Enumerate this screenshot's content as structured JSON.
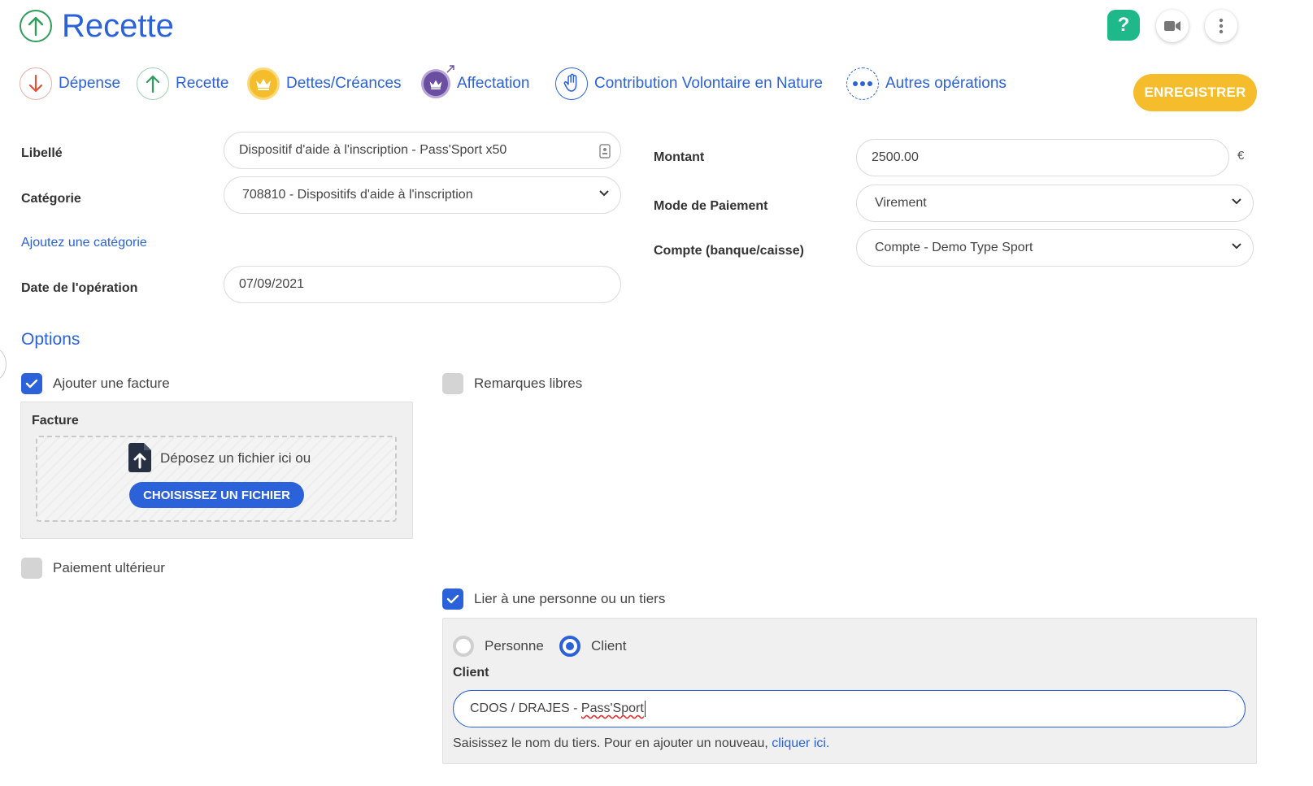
{
  "header": {
    "title": "Recette",
    "help_label": "?"
  },
  "operations": [
    {
      "label": "Dépense",
      "icon": "arrow-down-icon",
      "color": "#e0533d"
    },
    {
      "label": "Recette",
      "icon": "arrow-up-icon",
      "color": "#2e9e5b"
    },
    {
      "label": "Dettes/Créances",
      "icon": "crown-icon",
      "color": "#f5bd2b"
    },
    {
      "label": "Affectation",
      "icon": "crown-arrow-icon",
      "color": "#6b4ea0"
    },
    {
      "label": "Contribution Volontaire en Nature",
      "icon": "hand-icon",
      "color": "#2b62d9"
    },
    {
      "label": "Autres opérations",
      "icon": "more-horizontal-icon",
      "color": "#2b62d9"
    }
  ],
  "save_label": "ENREGISTRER",
  "form": {
    "libelle_label": "Libellé",
    "libelle_value": "Dispositif d'aide à l'inscription - Pass'Sport x50",
    "categorie_label": "Catégorie",
    "categorie_value": "708810 - Dispositifs d'aide à l'inscription",
    "add_category_link": "Ajoutez une catégorie",
    "date_label": "Date de l'opération",
    "date_value": "07/09/2021",
    "montant_label": "Montant",
    "montant_value": "2500.00",
    "currency": "€",
    "mode_label": "Mode de Paiement",
    "mode_value": "Virement",
    "compte_label": "Compte (banque/caisse)",
    "compte_value": "Compte - Demo Type Sport"
  },
  "options": {
    "title": "Options",
    "add_invoice_label": "Ajouter une facture",
    "add_invoice_checked": true,
    "remarks_label": "Remarques libres",
    "remarks_checked": false,
    "invoice_title": "Facture",
    "drop_text": "Déposez un fichier ici ou",
    "choose_file_label": "CHOISISSEZ UN FICHIER",
    "later_payment_label": "Paiement ultérieur",
    "later_payment_checked": false,
    "link_person_label": "Lier à une personne ou un tiers",
    "link_person_checked": true
  },
  "tiers": {
    "radio_person": "Personne",
    "radio_client": "Client",
    "selected": "Client",
    "client_title": "Client",
    "client_prefix": "CDOS / DRAJES - ",
    "client_suffix": "Pass'Sport",
    "help_text": "Saisissez le nom du tiers. Pour en ajouter un nouveau, ",
    "help_link": "cliquer ici."
  },
  "colors": {
    "primary": "#2b62d9",
    "accent": "#f5bd2b",
    "help": "#1fb88a"
  }
}
